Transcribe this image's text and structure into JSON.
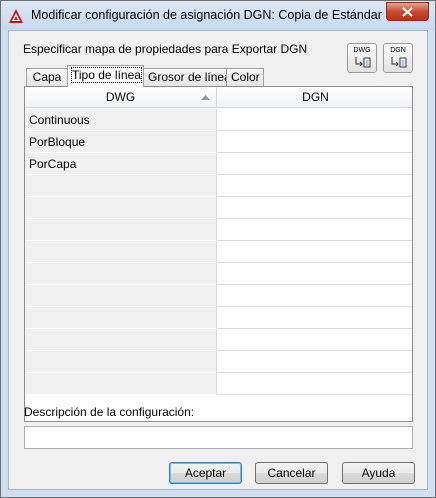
{
  "window": {
    "title": "Modificar configuración de asignación DGN: Copia de Estándar",
    "app_icon": "autocad-icon",
    "close_icon": "close-icon"
  },
  "header": {
    "subtitle": "Especificar mapa de propiedades para Exportar DGN",
    "map_buttons": [
      {
        "label": "DWG",
        "icon": "map-dwg-to-dgn-icon"
      },
      {
        "label": "DGN",
        "icon": "map-dgn-to-dwg-icon"
      }
    ]
  },
  "tabs": [
    {
      "label": "Capa",
      "active": false
    },
    {
      "label": "Tipo de línea",
      "active": true
    },
    {
      "label": "Grosor de línea",
      "active": false
    },
    {
      "label": "Color",
      "active": false
    }
  ],
  "grid": {
    "columns": [
      "DWG",
      "DGN"
    ],
    "sort_column": "DWG",
    "sort_direction": "ascending",
    "rows": [
      {
        "dwg": "Continuous",
        "dgn": ""
      },
      {
        "dwg": "PorBloque",
        "dgn": ""
      },
      {
        "dwg": "PorCapa",
        "dgn": ""
      },
      {
        "dwg": "",
        "dgn": ""
      },
      {
        "dwg": "",
        "dgn": ""
      },
      {
        "dwg": "",
        "dgn": ""
      },
      {
        "dwg": "",
        "dgn": ""
      },
      {
        "dwg": "",
        "dgn": ""
      },
      {
        "dwg": "",
        "dgn": ""
      },
      {
        "dwg": "",
        "dgn": ""
      },
      {
        "dwg": "",
        "dgn": ""
      },
      {
        "dwg": "",
        "dgn": ""
      },
      {
        "dwg": "",
        "dgn": ""
      }
    ]
  },
  "description": {
    "label": "Descripción de la configuración:",
    "value": ""
  },
  "buttons": {
    "ok": "Aceptar",
    "cancel": "Cancelar",
    "help": "Ayuda"
  },
  "colors": {
    "title_bar": "#c6d9ef",
    "close_button": "#c94b34",
    "dialog_body": "#f0f0f0",
    "default_button_border": "#3c7fb1"
  }
}
